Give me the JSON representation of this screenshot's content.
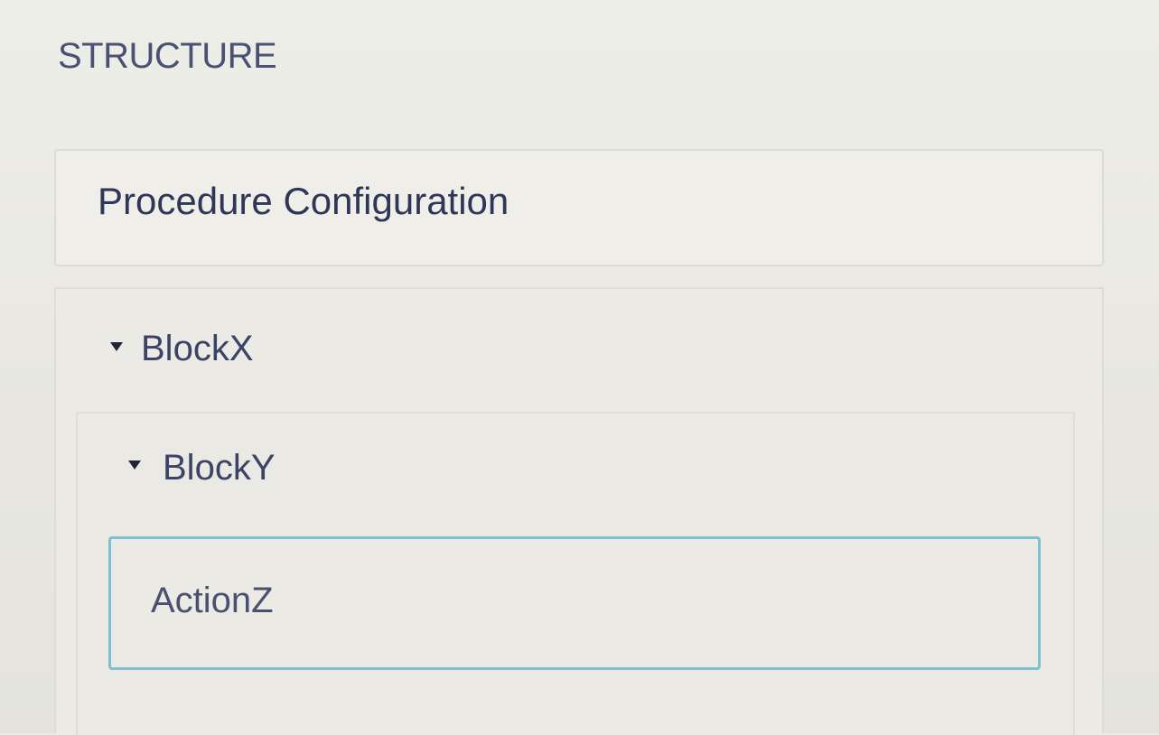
{
  "structure": {
    "title": "STRUCTURE",
    "procedure_configuration": "Procedure Configuration",
    "block_x": {
      "label": "BlockX",
      "expanded": true,
      "block_y": {
        "label": "BlockY",
        "expanded": true,
        "action_z": {
          "label": "ActionZ",
          "selected": true
        }
      }
    }
  },
  "colors": {
    "selection_border": "#7fc0ce",
    "background": "#ecebe6",
    "text": "#2d3550"
  }
}
